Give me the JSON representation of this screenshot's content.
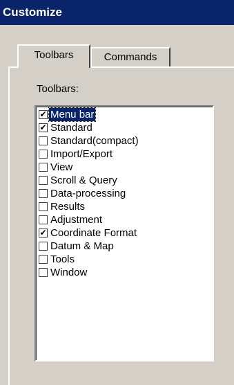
{
  "window": {
    "title": "Customize"
  },
  "tabs": [
    {
      "label": "Toolbars",
      "active": true
    },
    {
      "label": "Commands",
      "active": false
    }
  ],
  "toolbars_label": "Toolbars:",
  "toolbar_items": [
    {
      "label": "Menu bar",
      "checked": true,
      "selected": true
    },
    {
      "label": "Standard",
      "checked": true,
      "selected": false
    },
    {
      "label": "Standard(compact)",
      "checked": false,
      "selected": false
    },
    {
      "label": "Import/Export",
      "checked": false,
      "selected": false
    },
    {
      "label": "View",
      "checked": false,
      "selected": false
    },
    {
      "label": "Scroll & Query",
      "checked": false,
      "selected": false
    },
    {
      "label": "Data-processing",
      "checked": false,
      "selected": false
    },
    {
      "label": "Results",
      "checked": false,
      "selected": false
    },
    {
      "label": "Adjustment",
      "checked": false,
      "selected": false
    },
    {
      "label": "Coordinate Format",
      "checked": true,
      "selected": false
    },
    {
      "label": "Datum & Map",
      "checked": false,
      "selected": false
    },
    {
      "label": "Tools",
      "checked": false,
      "selected": false
    },
    {
      "label": "Window",
      "checked": false,
      "selected": false
    }
  ],
  "check_glyph": "✔",
  "colors": {
    "title_bar": "#0a246a",
    "face": "#d4d0c8",
    "selection": "#0a246a"
  }
}
